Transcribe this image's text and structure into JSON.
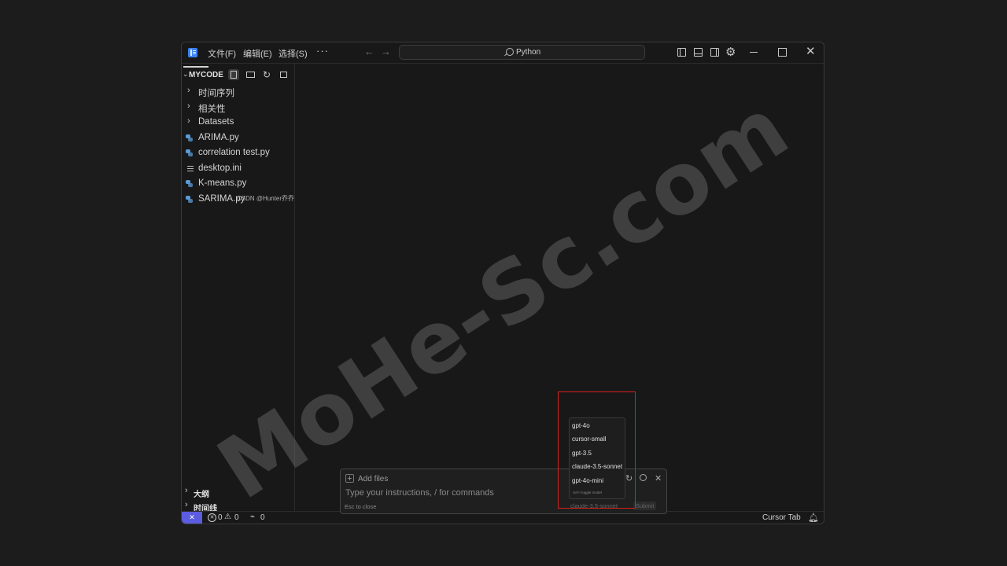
{
  "titlebar": {
    "menus": [
      "文件(F)",
      "编辑(E)",
      "选择(S)"
    ],
    "more": "···",
    "search_text": "Python"
  },
  "explorer": {
    "title": "MYCODE",
    "folders": [
      "时间序列",
      "相关性",
      "Datasets"
    ],
    "files": [
      {
        "name": "ARIMA.py",
        "icon": "python-icon"
      },
      {
        "name": "correlation test.py",
        "icon": "python-icon"
      },
      {
        "name": "desktop.ini",
        "icon": "settings-file-icon"
      },
      {
        "name": "K-means.py",
        "icon": "python-icon"
      },
      {
        "name": "SARIMA.py",
        "icon": "python-icon"
      }
    ],
    "overlay_text": "CSDN @Hunter乔乔",
    "outline_label": "大纲",
    "timeline_label": "时间线"
  },
  "statusbar": {
    "errors": "0",
    "warnings": "0",
    "ports": "0",
    "cursor_tab": "Cursor Tab"
  },
  "prompt": {
    "add_files": "Add files",
    "placeholder": "Type your instructions, / for commands",
    "esc_hint": "Esc to close",
    "model": "claude-3.5-sonnet",
    "submit": "Submit"
  },
  "model_menu": {
    "options": [
      "gpt-4o",
      "cursor-small",
      "gpt-3.5",
      "claude-3.5-sonnet",
      "gpt-4o-mini"
    ],
    "hint": "ctrl+/ toggle model"
  },
  "watermark": "MoHe-Sc.com",
  "colors": {
    "accent": "#5c5ce0",
    "highlight": "#d42020",
    "python": "#5b9bd5"
  }
}
